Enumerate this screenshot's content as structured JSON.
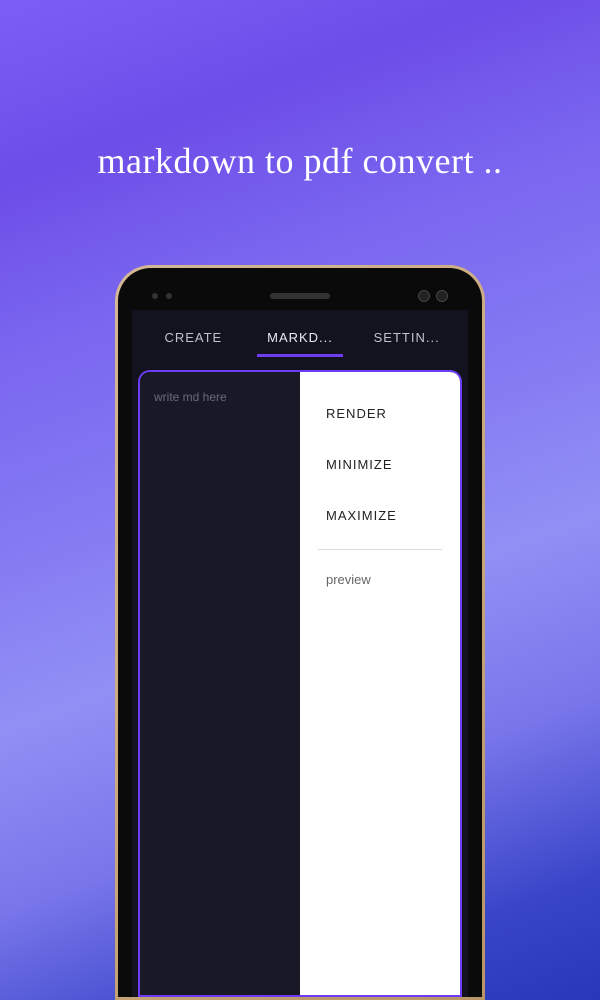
{
  "header": {
    "title": "markdown to pdf convert .."
  },
  "tabs": {
    "items": [
      {
        "label": "CREATE"
      },
      {
        "label": "MARKD..."
      },
      {
        "label": "SETTIN..."
      }
    ],
    "activeIndex": 1
  },
  "editor": {
    "placeholder": "write md here"
  },
  "previewPane": {
    "actions": [
      {
        "label": "RENDER"
      },
      {
        "label": "MINIMIZE"
      },
      {
        "label": "MAXIMIZE"
      }
    ],
    "previewLabel": "preview"
  }
}
